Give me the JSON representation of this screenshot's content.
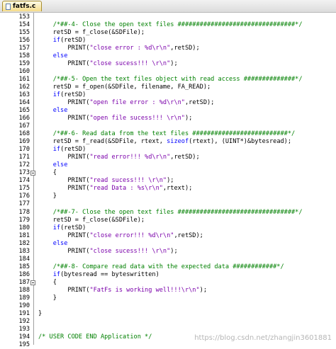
{
  "tab": {
    "filename": "fatfs.c"
  },
  "colors": {
    "comment": "#008000",
    "string": "#7a00aa",
    "keyword": "#0000ff"
  },
  "code_lines": [
    {
      "n": "153",
      "p": []
    },
    {
      "n": "154",
      "p": [
        [
          "    ",
          ""
        ],
        [
          "/*##-4- Close the open text files ################################*/",
          "cm"
        ]
      ]
    },
    {
      "n": "155",
      "p": [
        [
          "    retSD = f_close(&SDFile);",
          ""
        ]
      ]
    },
    {
      "n": "156",
      "p": [
        [
          "    ",
          ""
        ],
        [
          "if",
          "kw"
        ],
        [
          "(retSD)",
          ""
        ]
      ]
    },
    {
      "n": "157",
      "p": [
        [
          "        PRINT(",
          ""
        ],
        [
          "\"close error : %d\\r\\n\"",
          "str"
        ],
        [
          ",retSD);",
          ""
        ]
      ]
    },
    {
      "n": "158",
      "p": [
        [
          "    ",
          ""
        ],
        [
          "else",
          "kw"
        ]
      ]
    },
    {
      "n": "159",
      "p": [
        [
          "        PRINT(",
          ""
        ],
        [
          "\"close sucess!!! \\r\\n\"",
          "str"
        ],
        [
          ");",
          ""
        ]
      ]
    },
    {
      "n": "160",
      "p": []
    },
    {
      "n": "161",
      "p": [
        [
          "    ",
          ""
        ],
        [
          "/*##-5- Open the text files object with read access ##############*/",
          "cm"
        ]
      ]
    },
    {
      "n": "162",
      "p": [
        [
          "    retSD = f_open(&SDFile, filename, FA_READ);",
          ""
        ]
      ]
    },
    {
      "n": "163",
      "p": [
        [
          "    ",
          ""
        ],
        [
          "if",
          "kw"
        ],
        [
          "(retSD)",
          ""
        ]
      ]
    },
    {
      "n": "164",
      "p": [
        [
          "        PRINT(",
          ""
        ],
        [
          "\"open file error : %d\\r\\n\"",
          "str"
        ],
        [
          ",retSD);",
          ""
        ]
      ]
    },
    {
      "n": "165",
      "p": [
        [
          "    ",
          ""
        ],
        [
          "else",
          "kw"
        ]
      ]
    },
    {
      "n": "166",
      "p": [
        [
          "        PRINT(",
          ""
        ],
        [
          "\"open file sucess!!! \\r\\n\"",
          "str"
        ],
        [
          ");",
          ""
        ]
      ]
    },
    {
      "n": "167",
      "p": []
    },
    {
      "n": "168",
      "p": [
        [
          "    ",
          ""
        ],
        [
          "/*##-6- Read data from the text files ##########################*/",
          "cm"
        ]
      ]
    },
    {
      "n": "169",
      "p": [
        [
          "    retSD = f_read(&SDFile, rtext, ",
          ""
        ],
        [
          "sizeof",
          "kw"
        ],
        [
          "(rtext), (UINT*)&bytesread);",
          ""
        ]
      ]
    },
    {
      "n": "170",
      "p": [
        [
          "    ",
          ""
        ],
        [
          "if",
          "kw"
        ],
        [
          "(retSD)",
          ""
        ]
      ]
    },
    {
      "n": "171",
      "p": [
        [
          "        PRINT(",
          ""
        ],
        [
          "\"read error!!! %d\\r\\n\"",
          "str"
        ],
        [
          ",retSD);",
          ""
        ]
      ]
    },
    {
      "n": "172",
      "p": [
        [
          "    ",
          ""
        ],
        [
          "else",
          "kw"
        ]
      ]
    },
    {
      "n": "173",
      "p": [
        [
          "    {",
          ""
        ]
      ],
      "fold": true
    },
    {
      "n": "174",
      "p": [
        [
          "        PRINT(",
          ""
        ],
        [
          "\"read sucess!!! \\r\\n\"",
          "str"
        ],
        [
          ");",
          ""
        ]
      ]
    },
    {
      "n": "175",
      "p": [
        [
          "        PRINT(",
          ""
        ],
        [
          "\"read Data : %s\\r\\n\"",
          "str"
        ],
        [
          ",rtext);",
          ""
        ]
      ]
    },
    {
      "n": "176",
      "p": [
        [
          "    }",
          ""
        ]
      ]
    },
    {
      "n": "177",
      "p": []
    },
    {
      "n": "178",
      "p": [
        [
          "    ",
          ""
        ],
        [
          "/*##-7- Close the open text files ################################*/",
          "cm"
        ]
      ]
    },
    {
      "n": "179",
      "p": [
        [
          "    retSD = f_close(&SDFile);",
          ""
        ]
      ]
    },
    {
      "n": "180",
      "p": [
        [
          "    ",
          ""
        ],
        [
          "if",
          "kw"
        ],
        [
          "(retSD)",
          ""
        ]
      ]
    },
    {
      "n": "181",
      "p": [
        [
          "        PRINT(",
          ""
        ],
        [
          "\"close error!!! %d\\r\\n\"",
          "str"
        ],
        [
          ",retSD);",
          ""
        ]
      ]
    },
    {
      "n": "182",
      "p": [
        [
          "    ",
          ""
        ],
        [
          "else",
          "kw"
        ]
      ]
    },
    {
      "n": "183",
      "p": [
        [
          "        PRINT(",
          ""
        ],
        [
          "\"close sucess!!! \\r\\n\"",
          "str"
        ],
        [
          ");",
          ""
        ]
      ]
    },
    {
      "n": "184",
      "p": []
    },
    {
      "n": "185",
      "p": [
        [
          "    ",
          ""
        ],
        [
          "/*##-8- Compare read data with the expected data ############*/",
          "cm"
        ]
      ]
    },
    {
      "n": "186",
      "p": [
        [
          "    ",
          ""
        ],
        [
          "if",
          "kw"
        ],
        [
          "(bytesread == byteswritten)",
          ""
        ]
      ]
    },
    {
      "n": "187",
      "p": [
        [
          "    {",
          ""
        ]
      ],
      "fold": true
    },
    {
      "n": "188",
      "p": [
        [
          "        PRINT(",
          ""
        ],
        [
          "\"FatFs is working well!!!\\r\\n\"",
          "str"
        ],
        [
          ");",
          ""
        ]
      ]
    },
    {
      "n": "189",
      "p": [
        [
          "    }",
          ""
        ]
      ]
    },
    {
      "n": "190",
      "p": []
    },
    {
      "n": "191",
      "p": [
        [
          "}",
          ""
        ]
      ]
    },
    {
      "n": "192",
      "p": []
    },
    {
      "n": "193",
      "p": []
    },
    {
      "n": "194",
      "p": [
        [
          "/* USER CODE END Application */",
          "cm"
        ]
      ]
    },
    {
      "n": "195",
      "p": []
    }
  ],
  "watermark": "https://blog.csdn.net/zhangjin3601881"
}
